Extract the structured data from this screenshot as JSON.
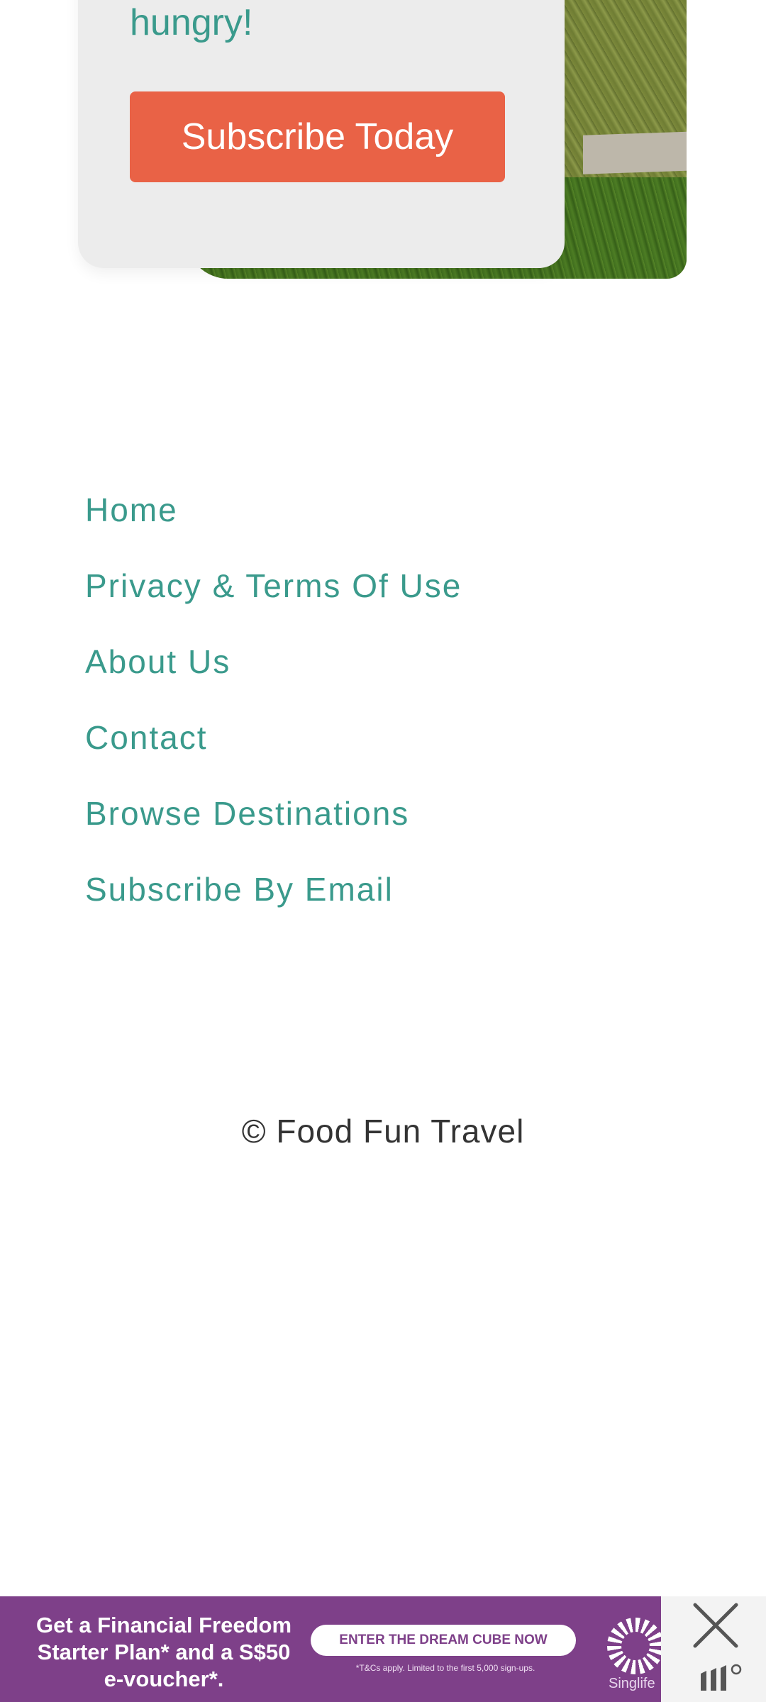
{
  "subscribe_card": {
    "text_tail": "hungry!",
    "button_label": "Subscribe Today"
  },
  "footer": {
    "links": [
      "Home",
      "Privacy & Terms Of Use",
      "About Us",
      "Contact",
      "Browse Destinations",
      "Subscribe By Email"
    ],
    "copyright": "© Food Fun Travel"
  },
  "ad": {
    "headline": "Get a Financial Freedom Starter Plan* and a S$50 e-voucher*.",
    "cta_label": "ENTER THE DREAM CUBE NOW",
    "fine_print": "*T&Cs apply. Limited to the first 5,000 sign-ups.",
    "brand": "Singlife",
    "close_icon": "close-icon",
    "colors": {
      "background": "#7e4089",
      "cta_text": "#7e4089"
    }
  },
  "colors": {
    "accent_teal": "#3a9a8c",
    "button_orange": "#e96246",
    "card_bg": "#ececec"
  }
}
